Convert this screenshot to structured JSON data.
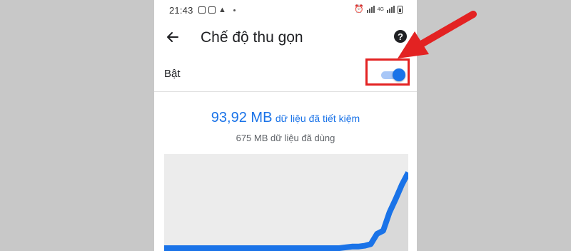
{
  "status_bar": {
    "time": "21:43",
    "left_icons": [
      "gallery-icon",
      "save-icon",
      "bag-icon",
      "dot"
    ],
    "right_icons": [
      "alarm-icon",
      "signal-icon",
      "network-4g",
      "signal-icon",
      "battery-icon"
    ],
    "network_label": "4G"
  },
  "header": {
    "back_icon": "arrow-left-icon",
    "title": "Chế độ thu gọn",
    "help_icon": "help-circle-icon",
    "help_glyph": "?"
  },
  "setting": {
    "label": "Bật",
    "toggle_on": true,
    "accent_color": "#1a73e8"
  },
  "summary": {
    "saved_amount": "93,92 MB",
    "saved_text": "dữ liệu đã tiết kiệm",
    "used_text": "675 MB dữ liệu đã dùng"
  },
  "chart_data": {
    "type": "area",
    "title": "",
    "xlabel": "",
    "ylabel": "",
    "series": [
      {
        "values": [
          0,
          0,
          0,
          0,
          0,
          0,
          0,
          0,
          0,
          0,
          0,
          0,
          0,
          0,
          0,
          0,
          0,
          0,
          0,
          0,
          0,
          0,
          0,
          0,
          0,
          0,
          0,
          0,
          0,
          1,
          2,
          2,
          3,
          5,
          18,
          22,
          45,
          62,
          80,
          95
        ]
      }
    ],
    "colors": {
      "line": "#1a73e8",
      "fill": "#d9d9d9",
      "background": "#ececec"
    }
  },
  "annotation": {
    "color": "#e32222",
    "target": "toggle"
  }
}
